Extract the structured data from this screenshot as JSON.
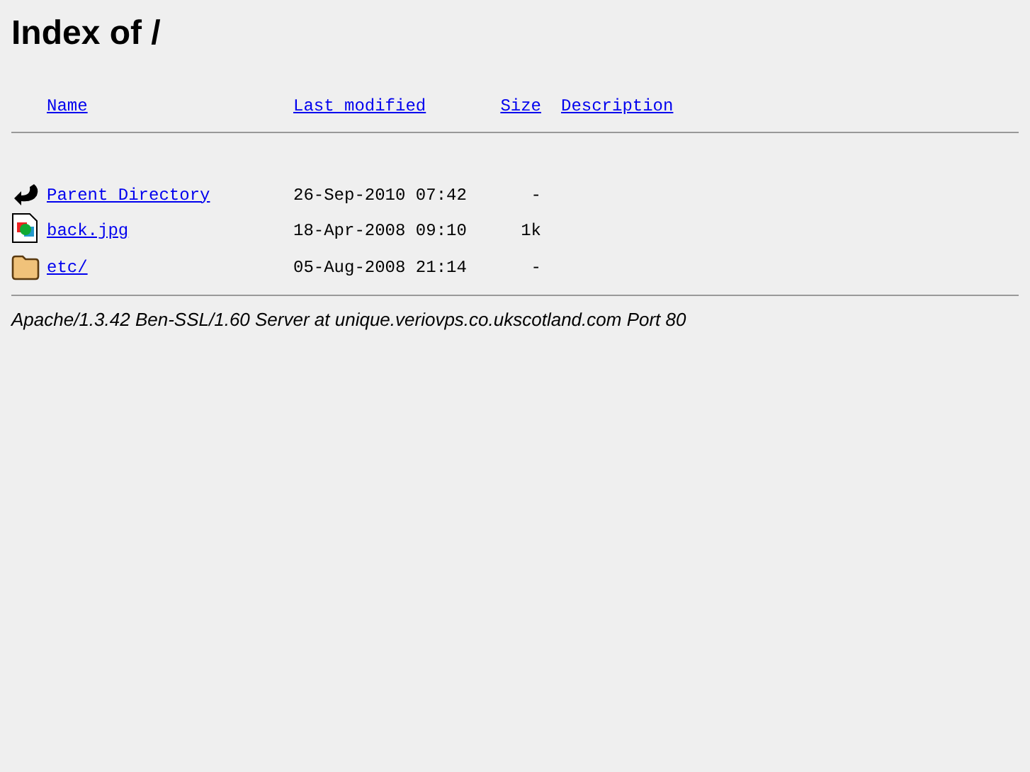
{
  "title": "Index of /",
  "columns": [
    "Name",
    "Last modified",
    "Size",
    "Description"
  ],
  "rows": [
    {
      "kind": "back",
      "name": "Parent Directory",
      "modified": "26-Sep-2010 07:42",
      "size": "-"
    },
    {
      "kind": "image",
      "name": "back.jpg",
      "modified": "18-Apr-2008 09:10",
      "size": "1k"
    },
    {
      "kind": "folder",
      "name": "etc/",
      "modified": "05-Aug-2008 21:14",
      "size": "-"
    }
  ],
  "footer": "Apache/1.3.42 Ben-SSL/1.60 Server at unique.veriovps.co.ukscotland.com Port 80"
}
